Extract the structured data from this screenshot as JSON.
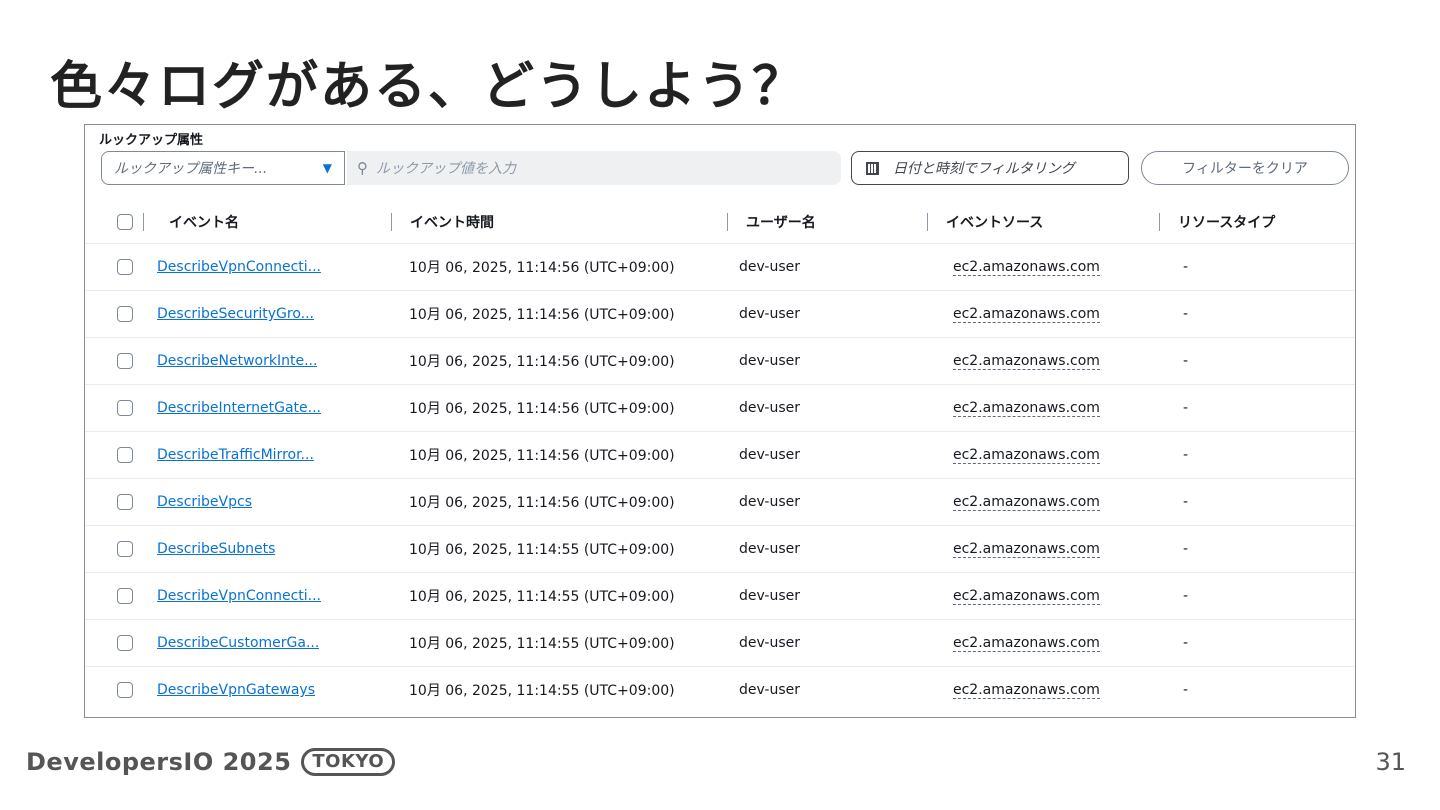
{
  "slide": {
    "title": "色々ログがある、どうしよう？",
    "page_number": "31"
  },
  "footer": {
    "brand": "DevelopersIO 2025",
    "badge": "TOKYO"
  },
  "lookup": {
    "label": "ルックアップ属性",
    "attribute_select": "ルックアップ属性キー...",
    "value_placeholder": "ルックアップ値を入力",
    "date_filter_button": "日付と時刻でフィルタリング",
    "clear_filter_button": "フィルターをクリア"
  },
  "table": {
    "columns": [
      "イベント名",
      "イベント時間",
      "ユーザー名",
      "イベントソース",
      "リソースタイプ"
    ],
    "rows": [
      {
        "name": "DescribeVpnConnecti...",
        "time": "10月 06, 2025, 11:14:56 (UTC+09:00)",
        "user": "dev-user",
        "source": "ec2.amazonaws.com",
        "resource": "-"
      },
      {
        "name": "DescribeSecurityGro...",
        "time": "10月 06, 2025, 11:14:56 (UTC+09:00)",
        "user": "dev-user",
        "source": "ec2.amazonaws.com",
        "resource": "-"
      },
      {
        "name": "DescribeNetworkInte...",
        "time": "10月 06, 2025, 11:14:56 (UTC+09:00)",
        "user": "dev-user",
        "source": "ec2.amazonaws.com",
        "resource": "-"
      },
      {
        "name": "DescribeInternetGate...",
        "time": "10月 06, 2025, 11:14:56 (UTC+09:00)",
        "user": "dev-user",
        "source": "ec2.amazonaws.com",
        "resource": "-"
      },
      {
        "name": "DescribeTrafficMirror...",
        "time": "10月 06, 2025, 11:14:56 (UTC+09:00)",
        "user": "dev-user",
        "source": "ec2.amazonaws.com",
        "resource": "-"
      },
      {
        "name": "DescribeVpcs",
        "time": "10月 06, 2025, 11:14:56 (UTC+09:00)",
        "user": "dev-user",
        "source": "ec2.amazonaws.com",
        "resource": "-"
      },
      {
        "name": "DescribeSubnets",
        "time": "10月 06, 2025, 11:14:55 (UTC+09:00)",
        "user": "dev-user",
        "source": "ec2.amazonaws.com",
        "resource": "-"
      },
      {
        "name": "DescribeVpnConnecti...",
        "time": "10月 06, 2025, 11:14:55 (UTC+09:00)",
        "user": "dev-user",
        "source": "ec2.amazonaws.com",
        "resource": "-"
      },
      {
        "name": "DescribeCustomerGa...",
        "time": "10月 06, 2025, 11:14:55 (UTC+09:00)",
        "user": "dev-user",
        "source": "ec2.amazonaws.com",
        "resource": "-"
      },
      {
        "name": "DescribeVpnGateways",
        "time": "10月 06, 2025, 11:14:55 (UTC+09:00)",
        "user": "dev-user",
        "source": "ec2.amazonaws.com",
        "resource": "-"
      }
    ]
  },
  "icons": {
    "dropdown": "caret-down-icon",
    "search": "search-icon",
    "calendar": "calendar-icon"
  },
  "colors": {
    "link": "#0972d3",
    "title": "#222222"
  }
}
